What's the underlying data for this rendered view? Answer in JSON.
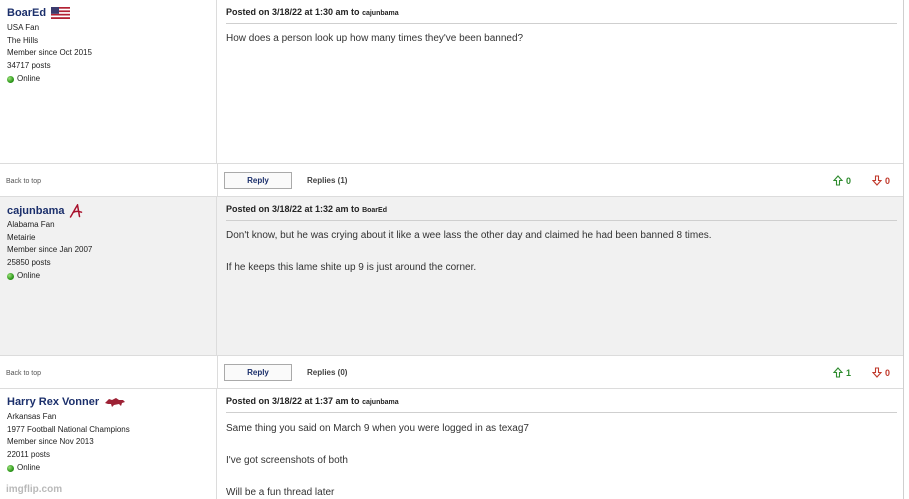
{
  "posts": [
    {
      "username": "BoarEd",
      "icon": "usa-flag-icon",
      "info": [
        "USA Fan",
        "The Hills",
        "Member since Oct 2015",
        "34717 posts"
      ],
      "status": "Online",
      "posted": "Posted on 3/18/22 at 1:30 am to",
      "to": "cajunbama",
      "lines": [
        "How does a person look up how many times they've been banned?"
      ],
      "back_to_top": "Back to top",
      "reply": "Reply",
      "replies": "Replies (1)",
      "up": "0",
      "down": "0"
    },
    {
      "username": "cajunbama",
      "icon": "alabama-a-icon",
      "info": [
        "Alabama Fan",
        "Metairie",
        "Member since Jan 2007",
        "25850 posts"
      ],
      "status": "Online",
      "posted": "Posted on 3/18/22 at 1:32 am to",
      "to": "BoarEd",
      "lines": [
        "Don't know, but he was crying about it like a wee lass the other day and claimed he had been banned 8 times.",
        "If he keeps this lame shite up 9 is just around the corner."
      ],
      "back_to_top": "Back to top",
      "reply": "Reply",
      "replies": "Replies (0)",
      "up": "1",
      "down": "0"
    },
    {
      "username": "Harry Rex Vonner",
      "icon": "razorback-hog-icon",
      "info": [
        "Arkansas Fan",
        "1977 Football National Champions",
        "Member since Nov 2013",
        "22011 posts"
      ],
      "status": "Online",
      "posted": "Posted on 3/18/22 at 1:37 am to",
      "to": "cajunbama",
      "lines": [
        "Same thing you said on March 9 when you were logged in as texag7",
        "I've got screenshots of both",
        "Will be a fun thread later"
      ]
    }
  ],
  "watermark": "imgflip.com",
  "colors": {
    "username": "#1b2f6b",
    "upvote": "#2e8b2e",
    "downvote": "#c0392b",
    "alt_row": "#f1f1f1"
  }
}
